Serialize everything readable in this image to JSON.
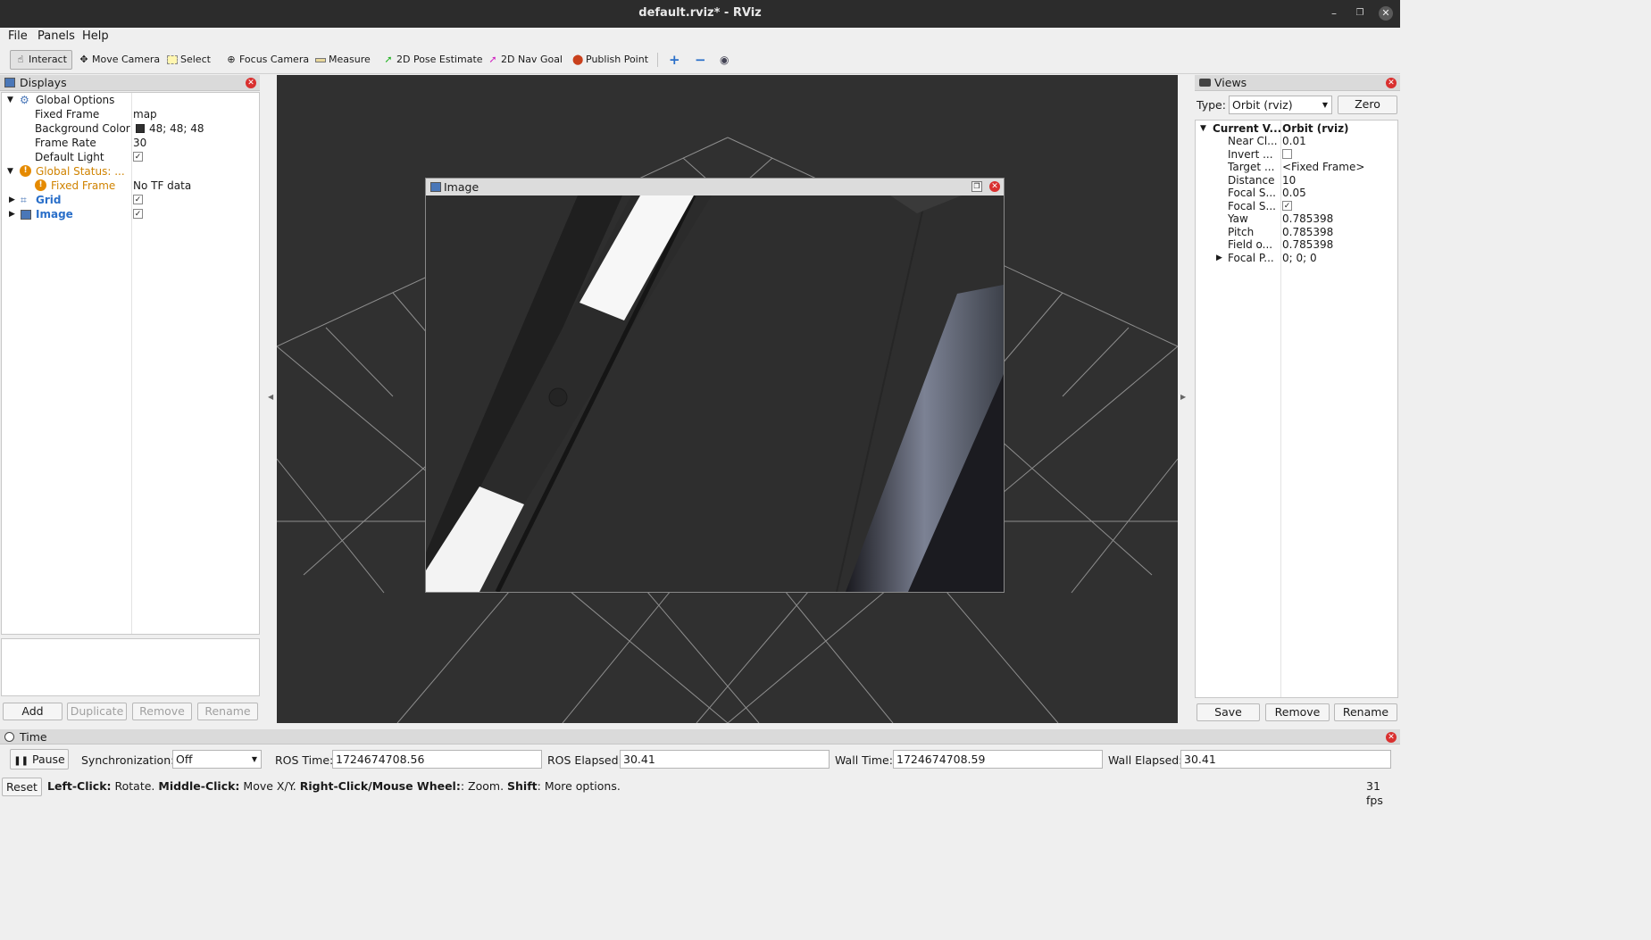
{
  "window": {
    "title": "default.rviz* - RViz"
  },
  "menu": [
    "File",
    "Panels",
    "Help"
  ],
  "toolbar": {
    "tools": [
      "Interact",
      "Move Camera",
      "Select",
      "Focus Camera",
      "Measure",
      "2D Pose Estimate",
      "2D Nav Goal",
      "Publish Point"
    ]
  },
  "displays": {
    "title": "Displays",
    "global_options": "Global Options",
    "fixed_frame_label": "Fixed Frame",
    "fixed_frame_value": "map",
    "background_color_label": "Background Color",
    "background_color_value": "48; 48; 48",
    "background_color_swatch": "#303030",
    "frame_rate_label": "Frame Rate",
    "frame_rate_value": "30",
    "default_light_label": "Default Light",
    "global_status_label": "Global Status: ...",
    "status_fixed_frame_label": "Fixed Frame",
    "status_fixed_frame_value": "No TF data",
    "grid_label": "Grid",
    "image_label": "Image",
    "buttons": {
      "add": "Add",
      "duplicate": "Duplicate",
      "remove": "Remove",
      "rename": "Rename"
    }
  },
  "image_window": {
    "title": "Image"
  },
  "views": {
    "title": "Views",
    "type_label": "Type:",
    "type_value": "Orbit (rviz)",
    "zero_button": "Zero",
    "header_name": "Current V...",
    "header_value": "Orbit (rviz)",
    "props": [
      {
        "name": "Near Cl...",
        "value": "0.01"
      },
      {
        "name": "Invert ...",
        "value": ""
      },
      {
        "name": "Target ...",
        "value": "<Fixed Frame>"
      },
      {
        "name": "Distance",
        "value": "10"
      },
      {
        "name": "Focal S...",
        "value": "0.05"
      },
      {
        "name": "Focal S...",
        "value": ""
      },
      {
        "name": "Yaw",
        "value": "0.785398"
      },
      {
        "name": "Pitch",
        "value": "0.785398"
      },
      {
        "name": "Field o...",
        "value": "0.785398"
      },
      {
        "name": "Focal P...",
        "value": "0; 0; 0"
      }
    ],
    "buttons": {
      "save": "Save",
      "remove": "Remove",
      "rename": "Rename"
    }
  },
  "time": {
    "title": "Time",
    "pause": "Pause",
    "sync_label": "Synchronization:",
    "sync_value": "Off",
    "ros_time_label": "ROS Time:",
    "ros_time_value": "1724674708.56",
    "ros_elapsed_label": "ROS Elapsed:",
    "ros_elapsed_value": "30.41",
    "wall_time_label": "Wall Time:",
    "wall_time_value": "1724674708.59",
    "wall_elapsed_label": "Wall Elapsed:",
    "wall_elapsed_value": "30.41"
  },
  "status": {
    "reset": "Reset",
    "hint_k1": "Left-Click:",
    "hint_v1": "Rotate.",
    "hint_k2": "Middle-Click:",
    "hint_v2": "Move X/Y.",
    "hint_k3": "Right-Click/Mouse Wheel:",
    "hint_v3": ": Zoom.",
    "hint_k4": "Shift",
    "hint_v4": ": More options.",
    "fps": "31 fps"
  },
  "colors": {
    "viewport_bg": "#303030",
    "accent_blue": "#2a6fc9",
    "warning": "#e58a00",
    "close_red": "#d9302f"
  }
}
